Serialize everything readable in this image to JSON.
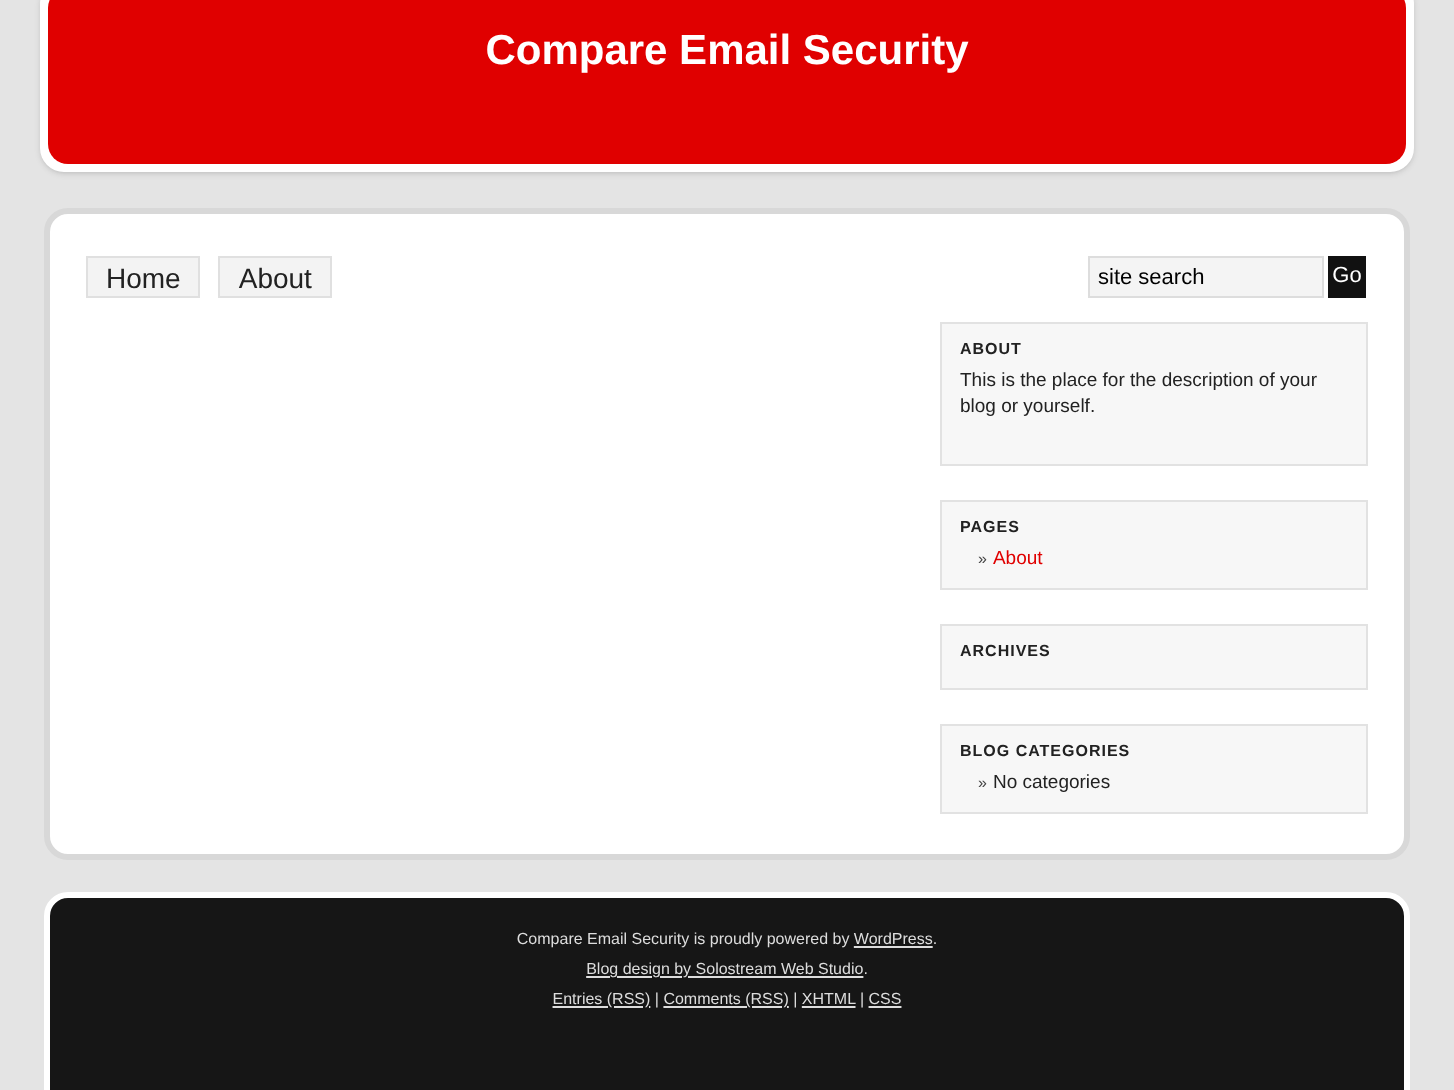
{
  "header": {
    "title": "Compare Email Security"
  },
  "nav": [
    {
      "label": "Home"
    },
    {
      "label": "About"
    }
  ],
  "search": {
    "value": "site search",
    "button": "Go"
  },
  "widgets": [
    {
      "title": "ABOUT",
      "kind": "text",
      "text": "This is the place for the description of your blog or yourself."
    },
    {
      "title": "PAGES",
      "kind": "list",
      "items": [
        {
          "bullet": "»",
          "label": "About",
          "link": true
        }
      ]
    },
    {
      "title": "ARCHIVES",
      "kind": "list"
    },
    {
      "title": "BLOG CATEGORIES",
      "kind": "list",
      "items": [
        {
          "bullet": "»",
          "label": "No categories",
          "link": false
        }
      ]
    }
  ],
  "footer": {
    "lines": [
      [
        {
          "t": "Compare Email Security is proudly powered by "
        },
        {
          "t": "WordPress",
          "link": true
        },
        {
          "t": "."
        }
      ],
      [
        {
          "t": "Blog design by Solostream Web Studio",
          "link": true
        },
        {
          "t": "."
        }
      ],
      [
        {
          "t": "Entries (RSS)",
          "link": true
        },
        {
          "t": " | "
        },
        {
          "t": "Comments (RSS)",
          "link": true
        },
        {
          "t": " | "
        },
        {
          "t": "XHTML",
          "link": true
        },
        {
          "t": " | "
        },
        {
          "t": "CSS",
          "link": true
        }
      ]
    ]
  }
}
